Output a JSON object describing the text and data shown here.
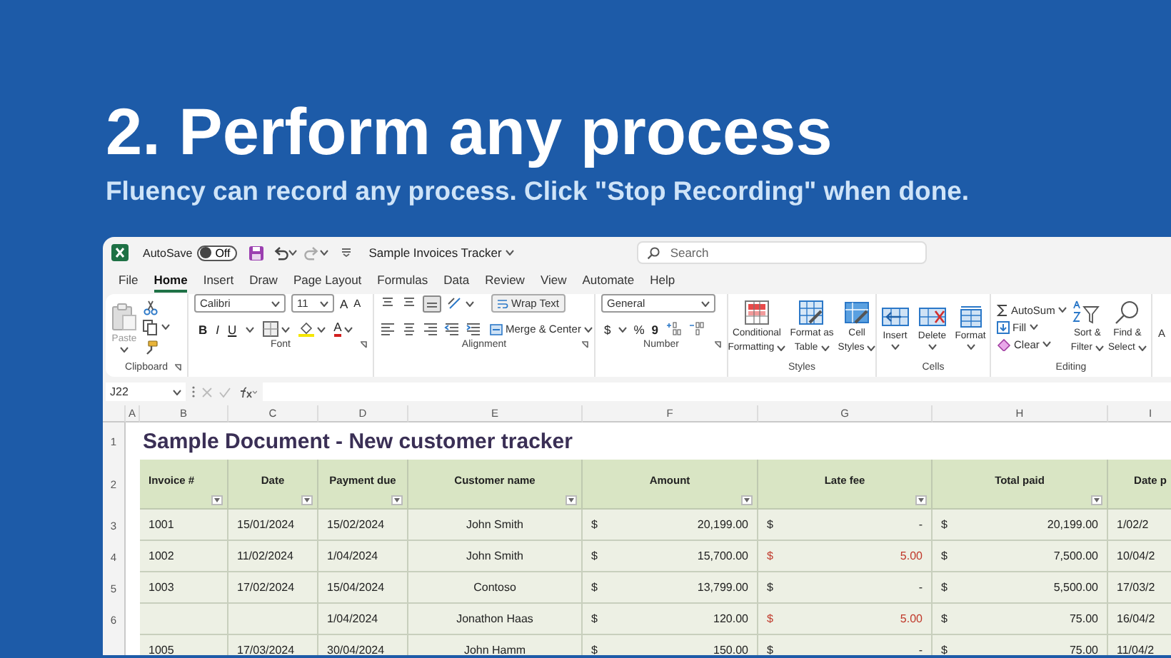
{
  "heading": {
    "title": "2. Perform any process",
    "subtitle": "Fluency can record any process. Click \"Stop Recording\" when done."
  },
  "titlebar": {
    "autosave_label": "AutoSave",
    "autosave": {
      "label": "Off",
      "on": false
    },
    "document_title": "Sample Invoices Tracker",
    "search": {
      "placeholder": "Search"
    }
  },
  "menu": [
    {
      "label": "File",
      "selected": false
    },
    {
      "label": "Home",
      "selected": true
    },
    {
      "label": "Insert",
      "selected": false
    },
    {
      "label": "Draw",
      "selected": false
    },
    {
      "label": "Page Layout",
      "selected": false
    },
    {
      "label": "Formulas",
      "selected": false
    },
    {
      "label": "Data",
      "selected": false
    },
    {
      "label": "Review",
      "selected": false
    },
    {
      "label": "View",
      "selected": false
    },
    {
      "label": "Automate",
      "selected": false
    },
    {
      "label": "Help",
      "selected": false
    }
  ],
  "ribbon": {
    "groups": [
      {
        "kind": "clipboard",
        "label": "Clipboard",
        "paste": "Paste"
      },
      {
        "kind": "font",
        "label": "Font",
        "font_name": "Calibri",
        "font_size": "11",
        "grow": "A",
        "shrink": "A",
        "bold": "B",
        "italic": "I",
        "underline": "U",
        "font_color": "A"
      },
      {
        "kind": "alignment",
        "label": "Alignment",
        "wrap_text": "Wrap Text",
        "merge": "Merge & Center"
      },
      {
        "kind": "number",
        "label": "Number",
        "format": "General",
        "currency": "$",
        "percent": "%",
        "comma": "9"
      },
      {
        "kind": "styles",
        "label": "Styles",
        "buttons": [
          {
            "line1": "Conditional",
            "line2": "Formatting"
          },
          {
            "line1": "Format as",
            "line2": "Table"
          },
          {
            "line1": "Cell",
            "line2": "Styles"
          }
        ]
      },
      {
        "kind": "cells",
        "label": "Cells",
        "buttons": [
          "Insert",
          "Delete",
          "Format"
        ]
      },
      {
        "kind": "editing",
        "label": "Editing",
        "autosum": "AutoSum",
        "fill": "Fill",
        "clear": "Clear",
        "sort": {
          "line1": "Sort &",
          "line2": "Filter"
        },
        "find": {
          "line1": "Find &",
          "line2": "Select"
        }
      },
      {
        "kind": "partial",
        "label": "A"
      }
    ]
  },
  "formula_bar": {
    "cell_ref": "J22"
  },
  "sheet": {
    "column_headers": [
      "A",
      "B",
      "C",
      "D",
      "E",
      "F",
      "G",
      "H",
      "I"
    ],
    "row_numbers": [
      "1",
      "2",
      "3",
      "4",
      "5",
      "6"
    ],
    "title": "Sample Document - New customer tracker",
    "columns": [
      "Invoice #",
      "Date",
      "Payment due",
      "Customer name",
      "Amount",
      "Late fee",
      "Total paid",
      "Date p"
    ],
    "rows": [
      {
        "invoice": "1001",
        "date": "15/01/2024",
        "payment_due": "15/02/2024",
        "customer": "John Smith",
        "amount": {
          "currency": "$",
          "value": "20,199.00"
        },
        "late_fee": {
          "currency": "$",
          "value": "-"
        },
        "late": false,
        "total_paid": {
          "currency": "$",
          "value": "20,199.00"
        },
        "date_paid": "1/02/2"
      },
      {
        "invoice": "1002",
        "date": "11/02/2024",
        "payment_due": "1/04/2024",
        "customer": "John Smith",
        "amount": {
          "currency": "$",
          "value": "15,700.00"
        },
        "late_fee": {
          "currency": "$",
          "value": "5.00"
        },
        "late": true,
        "total_paid": {
          "currency": "$",
          "value": "7,500.00"
        },
        "date_paid": "10/04/2"
      },
      {
        "invoice": "1003",
        "date": "17/02/2024",
        "payment_due": "15/04/2024",
        "customer": "Contoso",
        "amount": {
          "currency": "$",
          "value": "13,799.00"
        },
        "late_fee": {
          "currency": "$",
          "value": "-"
        },
        "late": false,
        "total_paid": {
          "currency": "$",
          "value": "5,500.00"
        },
        "date_paid": "17/03/2"
      },
      {
        "payment_due": "1/04/2024",
        "customer": "Jonathon Haas",
        "amount": {
          "currency": "$",
          "value": "120.00"
        },
        "late_fee": {
          "currency": "$",
          "value": "5.00"
        },
        "late": true,
        "total_paid": {
          "currency": "$",
          "value": "75.00"
        },
        "date_paid": "16/04/2"
      },
      {
        "invoice": "1005",
        "date": "17/03/2024",
        "payment_due": "30/04/2024",
        "customer": "John Hamm",
        "amount": {
          "currency": "$",
          "value": "150.00"
        },
        "late_fee": {
          "currency": "$",
          "value": "-"
        },
        "late": false,
        "total_paid": {
          "currency": "$",
          "value": "75.00"
        },
        "date_paid": "11/04/2"
      }
    ]
  }
}
